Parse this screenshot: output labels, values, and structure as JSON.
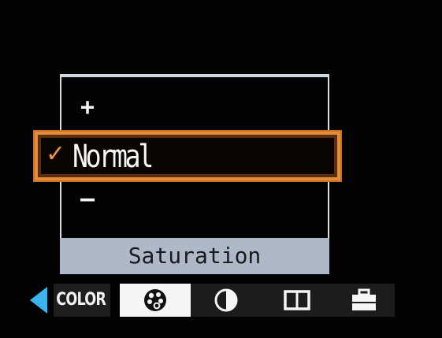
{
  "menu": {
    "options": {
      "plus": "+",
      "normal": "Normal",
      "minus": "–"
    },
    "selected_marker": "✓",
    "title": "Saturation"
  },
  "tabs": {
    "section_label": "COLOR",
    "items": [
      {
        "icon": "color-palette-icon",
        "active": true
      },
      {
        "icon": "contrast-icon",
        "active": false
      },
      {
        "icon": "frame-icon",
        "active": false
      },
      {
        "icon": "toolbox-icon",
        "active": false
      }
    ]
  },
  "colors": {
    "selection_outline": "#e58b3c",
    "title_bar": "#aeb8c9",
    "back_arrow": "#3ab3ee"
  }
}
